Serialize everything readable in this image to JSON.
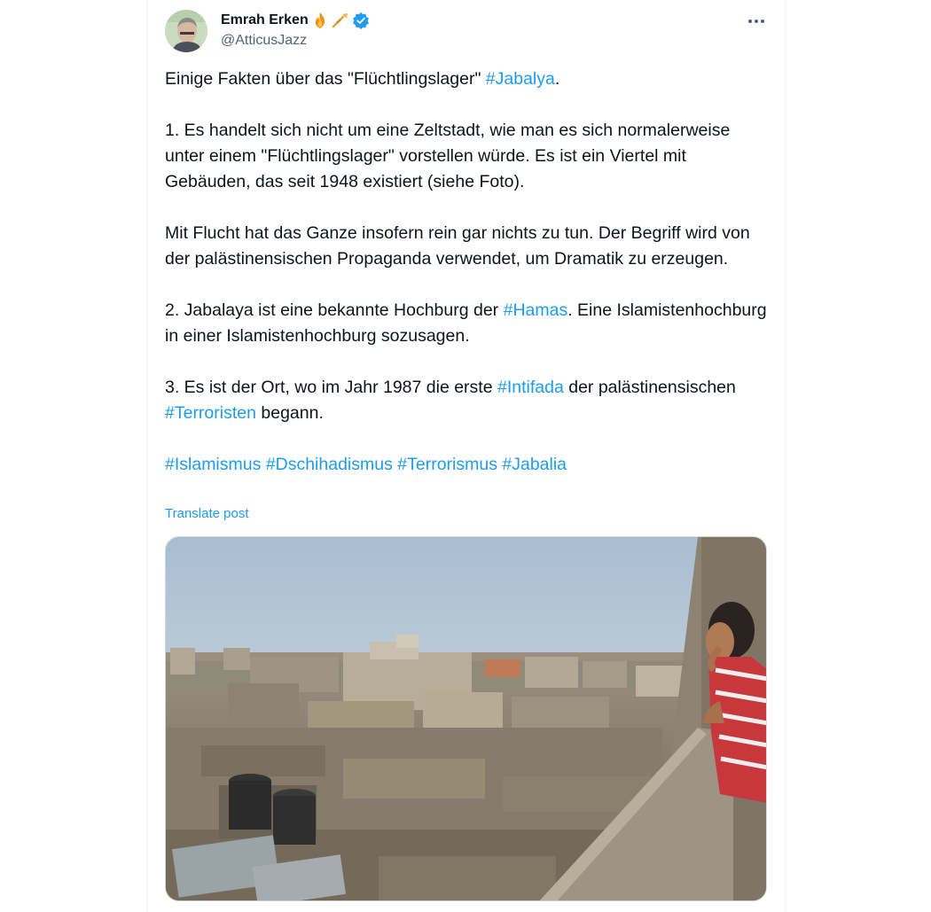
{
  "author": {
    "name": "Emrah Erken",
    "handle": "@AtticusJazz",
    "emojis": [
      "fire-emoji",
      "trumpet-emoji"
    ],
    "verified_badge": "verified-icon"
  },
  "more_icon": "more-options-icon",
  "tweet": {
    "p1": {
      "t1": "Einige Fakten über das \"Flüchtlingslager\" ",
      "h1": "#Jabalya",
      "t2": "."
    },
    "p2": "1. Es handelt sich nicht um eine Zeltstadt, wie man es sich normalerweise unter einem \"Flüchtlingslager\" vorstellen würde. Es ist ein Viertel mit Gebäuden, das seit 1948 existiert (siehe Foto).",
    "p3": "Mit Flucht hat das Ganze insofern rein gar nichts zu tun. Der Begriff wird von der palästinensischen Propaganda verwendet, um Dramatik zu erzeugen.",
    "p4": {
      "t1": "2. Jabalaya ist eine bekannte Hochburg der ",
      "h1": "#Hamas",
      "t2": ". Eine Islamistenhochburg in einer Islamistenhochburg sozusagen."
    },
    "p5": {
      "t1": "3. Es ist der Ort, wo im Jahr 1987 die erste ",
      "h1": "#Intifada",
      "t2": " der palästinensischen ",
      "h2": "#Terroristen",
      "t3": " begann."
    },
    "p6": {
      "h1": "#Islamismus",
      "h2": "#Dschihadismus",
      "h3": "#Terrorismus",
      "h4": "#Jabalia"
    }
  },
  "translate_label": "Translate post",
  "colors": {
    "link": "#1d9bf0",
    "text": "#0f1419",
    "secondary": "#536471",
    "verified": "#1d9bf0"
  }
}
